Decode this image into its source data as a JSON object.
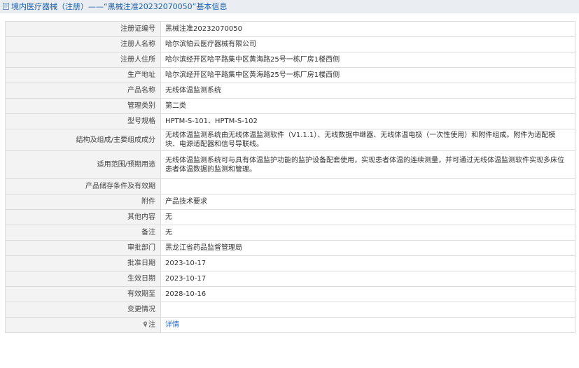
{
  "header": {
    "title": "境内医疗器械（注册）——“黑械注准20232070050”基本信息"
  },
  "rows": [
    {
      "label": "注册证编号",
      "value": "黑械注准20232070050"
    },
    {
      "label": "注册人名称",
      "value": "哈尔滨铂云医疗器械有限公司"
    },
    {
      "label": "注册人住所",
      "value": "哈尔滨经开区哈平路集中区黄海路25号一栋厂房1楼西侧"
    },
    {
      "label": "生产地址",
      "value": "哈尔滨经开区哈平路集中区黄海路25号一栋厂房1楼西侧"
    },
    {
      "label": "产品名称",
      "value": "无线体温监测系统"
    },
    {
      "label": "管理类别",
      "value": "第二类"
    },
    {
      "label": "型号规格",
      "value": "HPTM-S-101、HPTM-S-102"
    },
    {
      "label": "结构及组成/主要组成成分",
      "value": "无线体温监测系统由无线体温监测软件（V1.1.1）、无线数据中继器、无线体温电极（一次性使用）和附件组成。附件为适配模块、电源适配器和信号导联线。"
    },
    {
      "label": "适用范围/预期用途",
      "value": "无线体温监测系统可与具有体温监护功能的监护设备配套使用，实现患者体温的连续测量，并可通过无线体温监测软件实现多床位患者体温数据的监测和管理。"
    },
    {
      "label": "产品储存条件及有效期",
      "value": ""
    },
    {
      "label": "附件",
      "value": "产品技术要求"
    },
    {
      "label": "其他内容",
      "value": "无"
    },
    {
      "label": "备注",
      "value": "无"
    },
    {
      "label": "审批部门",
      "value": "黑龙江省药品监督管理局"
    },
    {
      "label": "批准日期",
      "value": "2023-10-17"
    },
    {
      "label": "生效日期",
      "value": "2023-10-17"
    },
    {
      "label": "有效期至",
      "value": "2028-10-16"
    },
    {
      "label": "变更情况",
      "value": ""
    }
  ],
  "note_row": {
    "label": "注",
    "link": "详情"
  },
  "colors": {
    "header_bg": "#eaeef3",
    "header_text": "#1d5fa8",
    "label_bg": "#f3f3f3",
    "border": "#dcdcdc",
    "link": "#2a6cc0"
  },
  "icons": {
    "header": "document-icon",
    "note": "pin-icon"
  }
}
